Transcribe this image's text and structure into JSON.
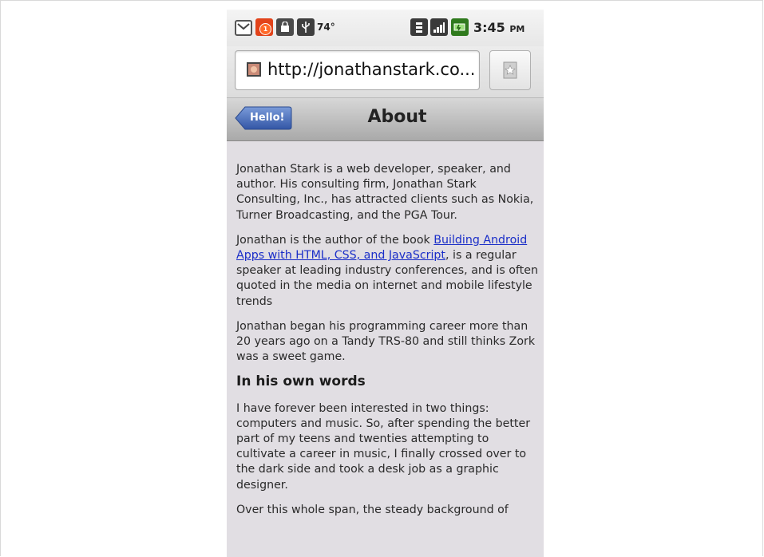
{
  "status_bar": {
    "icons": [
      "gmail-icon",
      "notification-icon",
      "market-icon",
      "usb-icon",
      "wifi-icon",
      "signal-icon",
      "battery-icon"
    ],
    "notification_count": "1",
    "temperature": "74°",
    "time": "3:45",
    "ampm": "PM"
  },
  "browser": {
    "url": "http://jonathanstark.co..."
  },
  "toolbar": {
    "back_label": "Hello!",
    "title": "About",
    "accent": "#3f63b0"
  },
  "content": {
    "p1": "Jonathan Stark is a web developer, speaker, and author. His consulting firm, Jonathan Stark Consulting, Inc., has attracted clients such as Nokia, Turner Broadcasting, and the PGA Tour.",
    "p2_before": "Jonathan is the author of the book ",
    "p2_link": "Building Android Apps with HTML, CSS, and JavaScript",
    "p2_after": ", is a regular speaker at leading industry conferences, and is often quoted in the media on internet and mobile lifestyle trends",
    "p3": "Jonathan began his programming career more than 20 years ago on a Tandy TRS-80 and still thinks Zork was a sweet game.",
    "heading": "In his own words",
    "p4": "I have forever been interested in two things: computers and music. So, after spending the better part of my teens and twenties attempting to cultivate a career in music, I finally crossed over to the dark side and took a desk job as a graphic designer.",
    "p5": "Over this whole span, the steady background of"
  }
}
